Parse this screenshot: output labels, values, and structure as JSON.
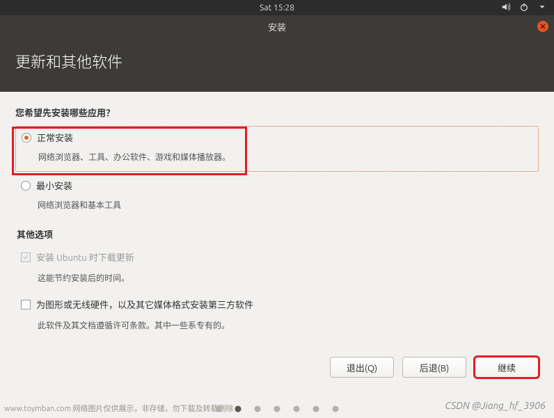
{
  "topbar": {
    "clock": "Sat 15:28"
  },
  "window": {
    "title": "安装"
  },
  "header": {
    "title": "更新和其他软件"
  },
  "question": "您希望先安装哪些应用？",
  "options": {
    "normal": {
      "label": "正常安装",
      "desc": "网络浏览器、工具、办公软件、游戏和媒体播放器。"
    },
    "minimal": {
      "label": "最小安装",
      "desc": "网络浏览器和基本工具"
    }
  },
  "other_title": "其他选项",
  "checks": {
    "download": {
      "label": "安装 Ubuntu 时下载更新",
      "desc": "这能节约安装后的时间。"
    },
    "thirdparty": {
      "label": "为图形或无线硬件，以及其它媒体格式安装第三方软件",
      "desc": "此软件及其文档遵循许可条款。其中一些系专有的。"
    }
  },
  "buttons": {
    "quit": "退出(Q)",
    "back": "后退(B)",
    "continue": "继续"
  },
  "footer": "www.toymban.com 网络图片仅供展示，非存储，勿下载及转载删除",
  "watermark": "CSDN @Jiang_hf_3906"
}
